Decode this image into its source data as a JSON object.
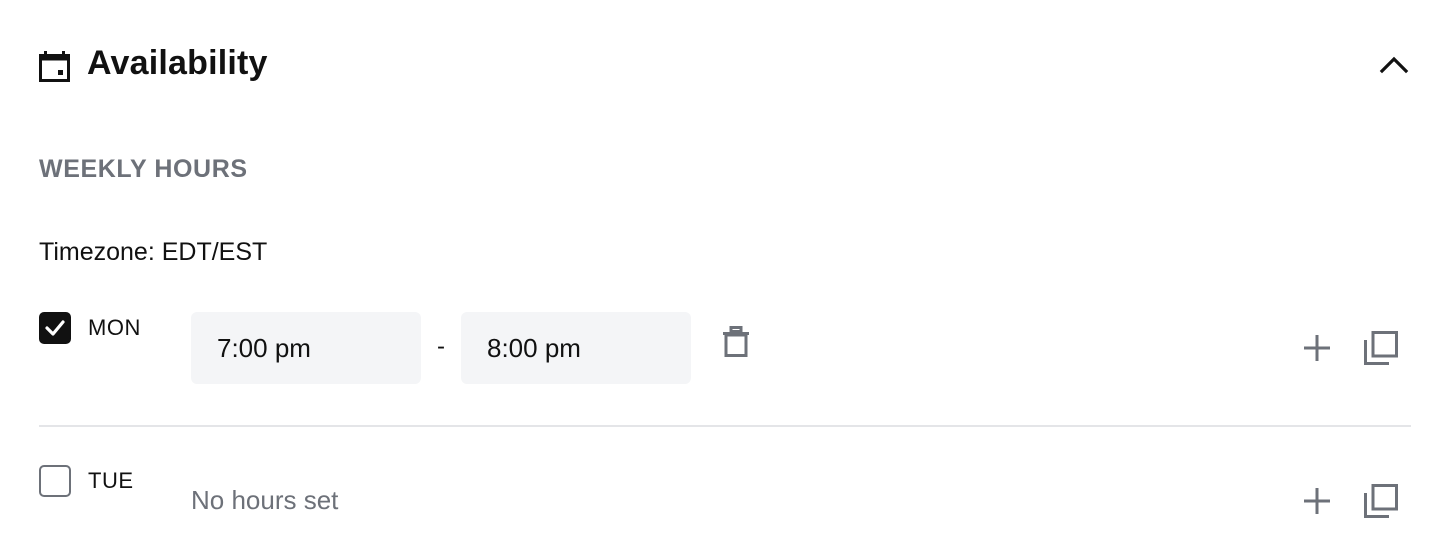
{
  "header": {
    "title": "Availability",
    "icon": "calendar-icon",
    "collapse_icon": "chevron-up-icon"
  },
  "section": {
    "label": "WEEKLY HOURS"
  },
  "timezone": {
    "text": "Timezone: EDT/EST"
  },
  "days": [
    {
      "label": "MON",
      "checked": true,
      "start": "7:00 pm",
      "separator": "-",
      "end": "8:00 pm"
    },
    {
      "label": "TUE",
      "checked": false,
      "empty_text": "No hours set"
    }
  ],
  "colors": {
    "text": "#111111",
    "muted": "#6d7179",
    "field_bg": "#f4f5f7",
    "divider": "#e4e5e8"
  }
}
